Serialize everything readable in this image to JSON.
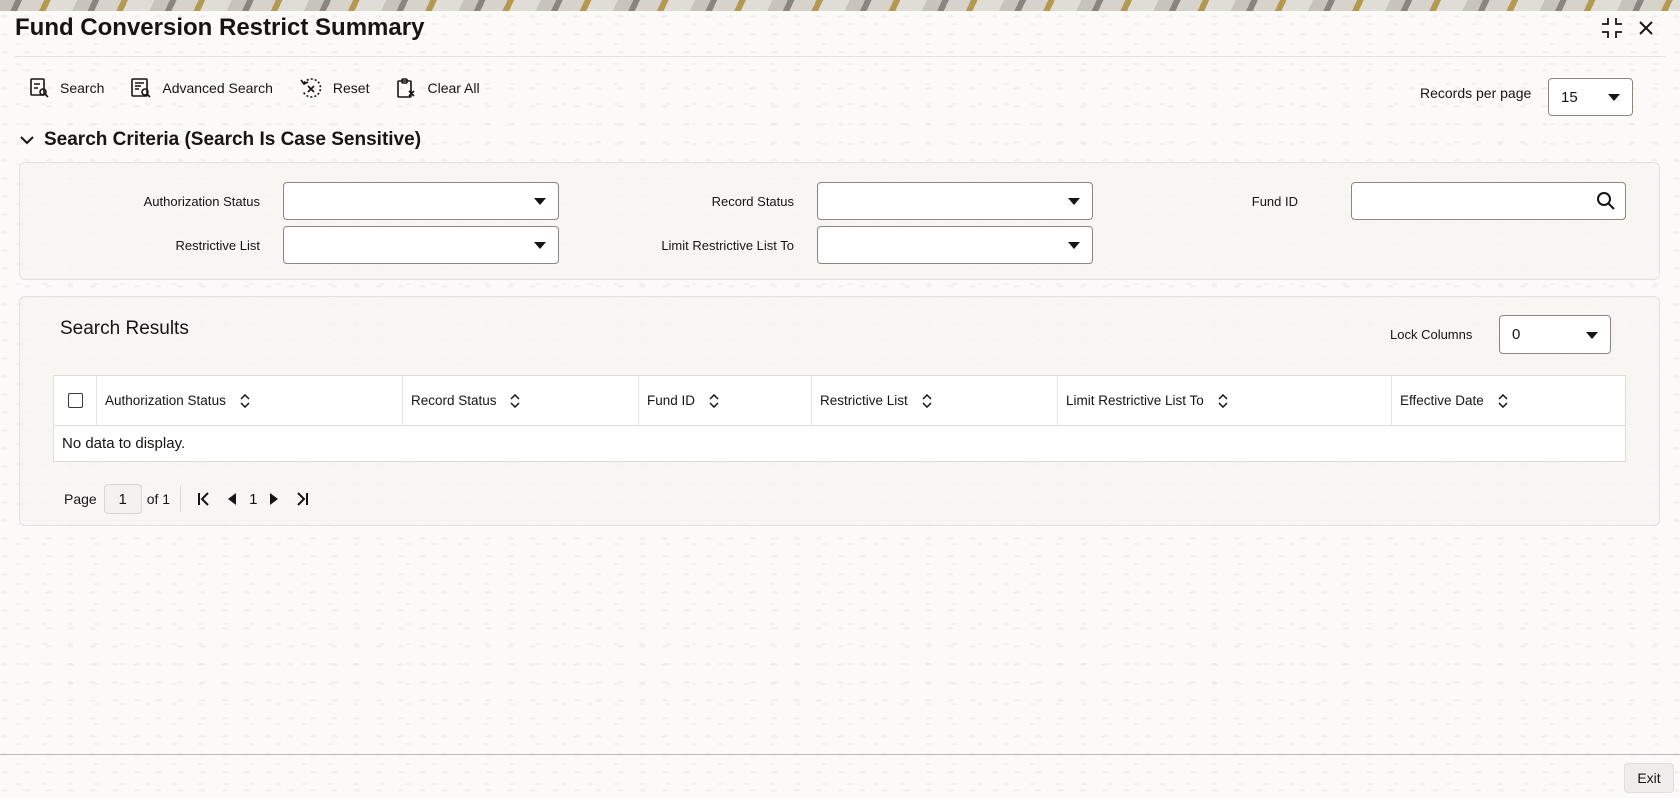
{
  "window": {
    "title": "Fund Conversion Restrict Summary",
    "maximize_icon": "expand-icon",
    "close_icon": "close-icon"
  },
  "toolbar": {
    "search_label": "Search",
    "advanced_search_label": "Advanced Search",
    "reset_label": "Reset",
    "clear_all_label": "Clear All",
    "records_per_page_label": "Records per page",
    "records_per_page_value": "15"
  },
  "criteria": {
    "header": "Search Criteria (Search Is Case Sensitive)",
    "authorization_status_label": "Authorization Status",
    "authorization_status_value": "",
    "record_status_label": "Record Status",
    "record_status_value": "",
    "fund_id_label": "Fund ID",
    "fund_id_value": "",
    "restrictive_list_label": "Restrictive List",
    "restrictive_list_value": "",
    "limit_restrictive_list_to_label": "Limit Restrictive List To",
    "limit_restrictive_list_to_value": ""
  },
  "results": {
    "title": "Search Results",
    "lock_columns_label": "Lock Columns",
    "lock_columns_value": "0",
    "columns": [
      "Authorization Status",
      "Record Status",
      "Fund ID",
      "Restrictive List",
      "Limit Restrictive List To",
      "Effective Date"
    ],
    "empty_message": "No data to display."
  },
  "pager": {
    "page_label": "Page",
    "current_page": "1",
    "of_label": "of 1",
    "page_number": "1"
  },
  "footer": {
    "exit_label": "Exit"
  },
  "colors": {
    "text": "#161513",
    "border": "#8b8680",
    "panel": "#f6f5f2"
  }
}
